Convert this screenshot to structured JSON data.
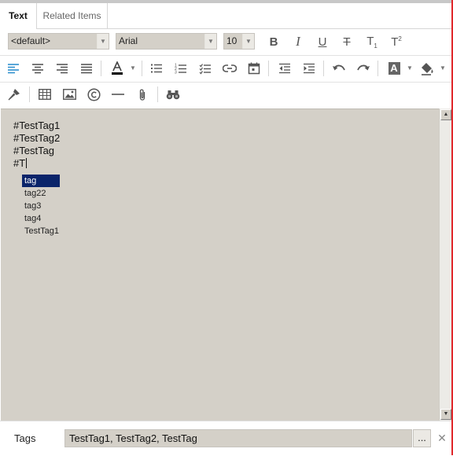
{
  "tabs": [
    {
      "label": "Text",
      "active": true
    },
    {
      "label": "Related Items",
      "active": false
    }
  ],
  "format": {
    "style_value": "<default>",
    "font_value": "Arial",
    "size_value": "10",
    "bold": "B",
    "italic": "I",
    "underline": "U",
    "strikethrough": "T",
    "subscript": "T",
    "subscript_mark": "1",
    "superscript": "T",
    "superscript_mark": "2",
    "highlight_letter": "A"
  },
  "editor": {
    "lines": [
      "#TestTag1",
      "#TestTag2",
      "#TestTag",
      "#T"
    ]
  },
  "suggestions": [
    "tag",
    "tag22",
    "tag3",
    "tag4",
    "TestTag1"
  ],
  "selected_suggestion_index": 0,
  "tags": {
    "label": "Tags",
    "value": "TestTag1, TestTag2, TestTag",
    "more_label": "...",
    "clear_label": "✕"
  },
  "colors": {
    "accent": "#2f8fce",
    "selection": "#0a246a",
    "editor_bg": "#d4d0c8",
    "window_edge": "#e0282c"
  }
}
